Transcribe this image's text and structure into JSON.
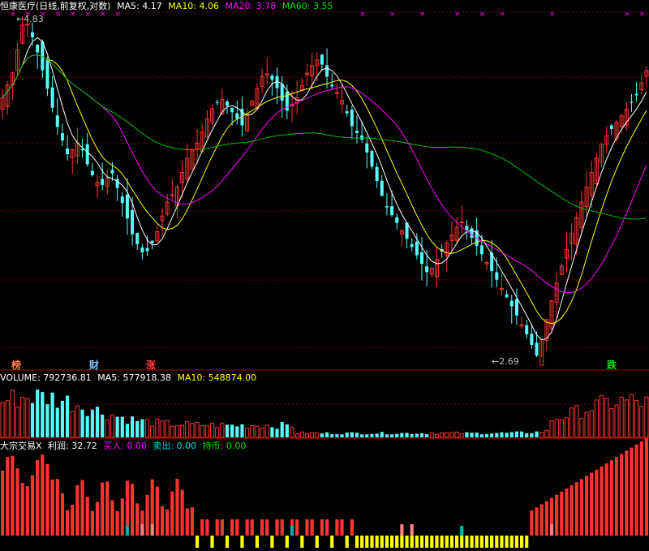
{
  "price_panel": {
    "title": "恒康医疗(日线,前复权,对数)",
    "ma5": "MA5: 4.17",
    "ma10": "MA10: 4.06",
    "ma20": "MA20: 3.78",
    "ma60": "MA60: 3.55",
    "high_label": "4.83",
    "low_label": "2.69",
    "badges": [
      "榜",
      "财",
      "涨",
      "跌"
    ]
  },
  "volume_panel": {
    "volume": "VOLUME: 792736.81",
    "ma5": "MA5: 577918.38",
    "ma10": "MA10: 548874.00"
  },
  "indicator_panel": {
    "name": "大宗交易X",
    "profit": "利润: 32.72",
    "buy": "买入: 0.00",
    "sell": "卖出: 0.00",
    "hold": "持币: 0.00"
  },
  "colors": {
    "up": "#ff3232",
    "down": "#54fcfc",
    "ma5": "#ffffff",
    "ma10": "#ffff00",
    "ma20": "#ff00ff",
    "ma60": "#00c000",
    "signal": "#ff00ff",
    "hold_bar": "#ffff00",
    "pink_bar": "#ff8080",
    "teal_bar": "#00b0b0"
  },
  "chart_data": {
    "type": "candlestick",
    "scale": "log",
    "price_range": [
      2.69,
      4.83
    ],
    "ohlc_path": [
      4.2,
      4.4,
      4.83,
      4.6,
      4.3,
      4.0,
      3.8,
      3.9,
      3.7,
      3.6,
      3.7,
      3.5,
      3.3,
      3.2,
      3.3,
      3.5,
      3.6,
      3.8,
      3.9,
      4.1,
      4.2,
      4.1,
      4.0,
      4.2,
      4.4,
      4.3,
      4.1,
      4.2,
      4.4,
      4.5,
      4.3,
      4.2,
      4.0,
      3.9,
      3.7,
      3.5,
      3.4,
      3.3,
      3.2,
      3.1,
      3.2,
      3.3,
      3.4,
      3.3,
      3.2,
      3.1,
      3.0,
      2.9,
      2.8,
      2.69,
      2.9,
      3.1,
      3.3,
      3.5,
      3.7,
      3.9,
      4.0,
      4.1,
      4.2,
      4.4
    ],
    "volume_pattern": "high-left, trough-middle, rising-right",
    "profit_value": 32.72
  }
}
